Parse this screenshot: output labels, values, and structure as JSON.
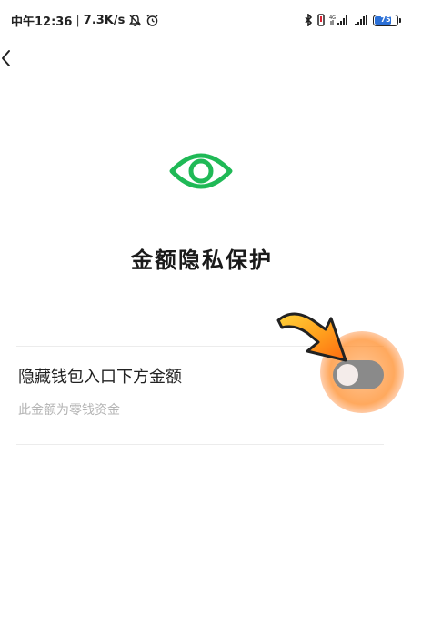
{
  "status_bar": {
    "time": "中午12:36",
    "separator": "|",
    "net_speed": "7.3K/s",
    "battery_level": "75",
    "battery_percent": 75,
    "icons": [
      "mute-bell-icon",
      "alarm-icon",
      "bluetooth-icon",
      "vibrate-icon",
      "4g-signal-icon",
      "signal-icon",
      "battery-icon"
    ]
  },
  "nav": {
    "back_icon": "chevron-left-icon"
  },
  "header": {
    "icon": "eye-icon",
    "title": "金额隐私保护"
  },
  "setting": {
    "label": "隐藏钱包入口下方金额",
    "sublabel": "此金额为零钱资金",
    "toggle_on": false
  },
  "colors": {
    "accent": "#1fb956",
    "toggle_off": "#8a8a8a",
    "highlight": "#ff8a1e"
  }
}
